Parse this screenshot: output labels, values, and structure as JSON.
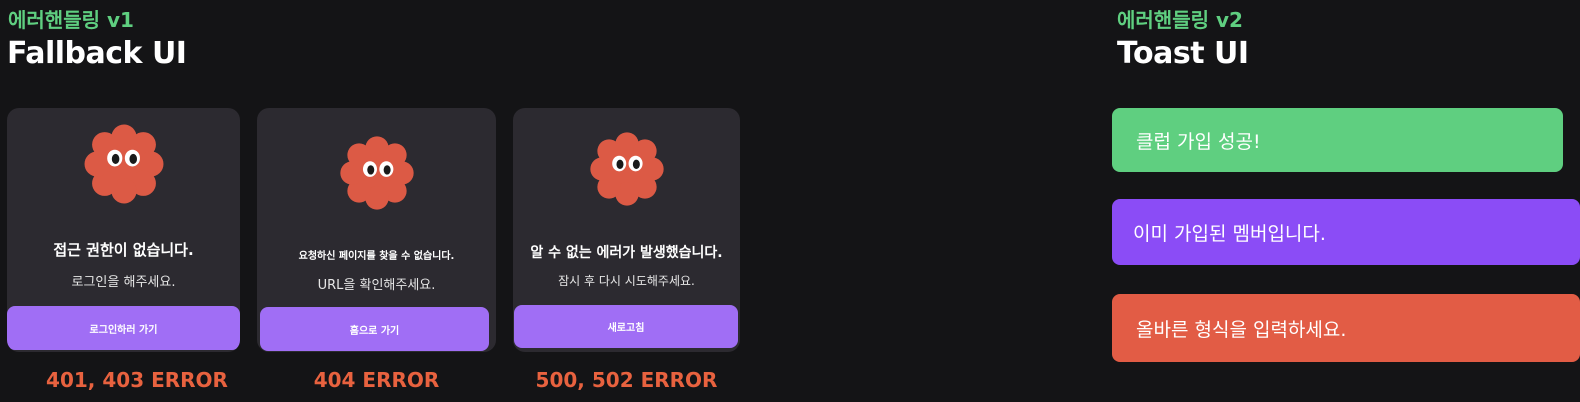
{
  "v1": {
    "tag": "에러핸들링 v1",
    "title": "Fallback UI",
    "cards": [
      {
        "title": "접근 권한이 없습니다.",
        "message": "로그인을 해주세요.",
        "button": "로그인하러 가기",
        "label": "401, 403 ERROR"
      },
      {
        "title": "요청하신 페이지를 찾을 수 없습니다.",
        "message": "URL을 확인해주세요.",
        "button": "홈으로 가기",
        "label": "404 ERROR"
      },
      {
        "title": "알 수 없는 에러가 발생했습니다.",
        "message": "잠시 후 다시 시도해주세요.",
        "button": "새로고침",
        "label": "500, 502 ERROR"
      }
    ]
  },
  "v2": {
    "tag": "에러핸들링 v2",
    "title": "Toast UI",
    "toasts": [
      {
        "message": "클럽 가입 성공!",
        "color": "#5fcf80"
      },
      {
        "message": "이미 가입된 멤버입니다.",
        "color": "#8b4cf6"
      },
      {
        "message": "올바른 형식을 입력하세요.",
        "color": "#e25c45"
      }
    ]
  },
  "colors": {
    "accent_green": "#5fcf80",
    "button_purple": "#a06ef5",
    "error_orange": "#e8623f",
    "mascot_red": "#dc5a45"
  }
}
